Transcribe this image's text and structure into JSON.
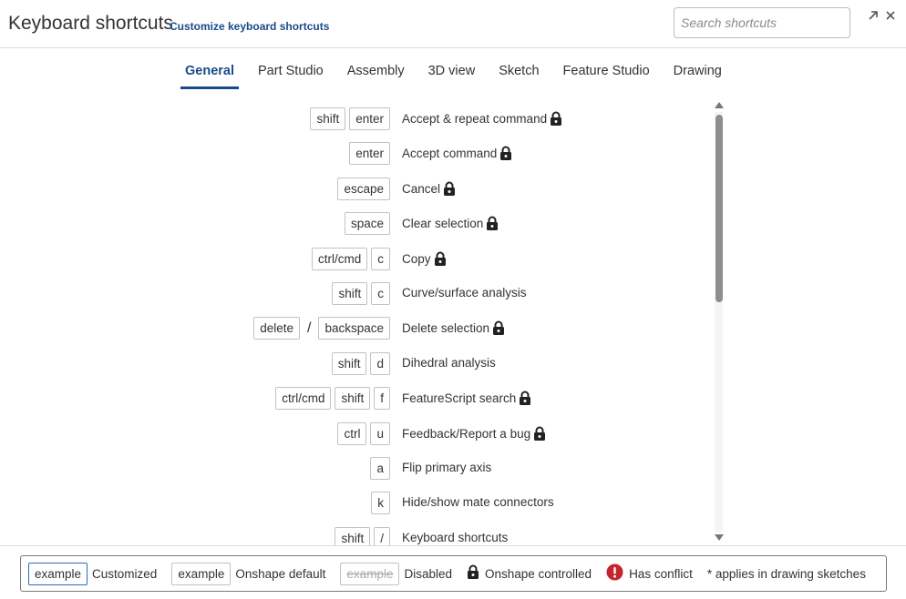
{
  "header": {
    "title": "Keyboard shortcuts",
    "subtitle": "Customize keyboard shortcuts",
    "search_placeholder": "Search shortcuts"
  },
  "tabs": [
    {
      "label": "General",
      "active": true
    },
    {
      "label": "Part Studio"
    },
    {
      "label": "Assembly"
    },
    {
      "label": "3D view"
    },
    {
      "label": "Sketch"
    },
    {
      "label": "Feature Studio"
    },
    {
      "label": "Drawing"
    }
  ],
  "shortcuts": [
    {
      "keys": [
        "shift",
        "enter"
      ],
      "label": "Accept & repeat command",
      "locked": true
    },
    {
      "keys": [
        "enter"
      ],
      "label": "Accept command",
      "locked": true
    },
    {
      "keys": [
        "escape"
      ],
      "label": "Cancel",
      "locked": true
    },
    {
      "keys": [
        "space"
      ],
      "label": "Clear selection",
      "locked": true
    },
    {
      "keys": [
        "ctrl/cmd",
        "c"
      ],
      "label": "Copy",
      "locked": true
    },
    {
      "keys": [
        "shift",
        "c"
      ],
      "label": "Curve/surface analysis",
      "locked": false
    },
    {
      "keys": [
        "delete"
      ],
      "alt_keys": [
        "backspace"
      ],
      "separator": "/",
      "label": "Delete selection",
      "locked": true
    },
    {
      "keys": [
        "shift",
        "d"
      ],
      "label": "Dihedral analysis",
      "locked": false
    },
    {
      "keys": [
        "ctrl/cmd",
        "shift",
        "f"
      ],
      "label": "FeatureScript search",
      "locked": true
    },
    {
      "keys": [
        "ctrl",
        "u"
      ],
      "label": "Feedback/Report a bug",
      "locked": true
    },
    {
      "keys": [
        "a"
      ],
      "label": "Flip primary axis",
      "locked": false
    },
    {
      "keys": [
        "k"
      ],
      "label": "Hide/show mate connectors",
      "locked": false
    },
    {
      "keys": [
        "shift",
        "/"
      ],
      "label": "Keyboard shortcuts",
      "locked": false
    }
  ],
  "legend": {
    "customized_example": "example",
    "customized_label": "Customized",
    "default_example": "example",
    "default_label": "Onshape default",
    "disabled_example": "example",
    "disabled_label": "Disabled",
    "controlled_label": "Onshape controlled",
    "conflict_label": "Has conflict",
    "drawing_label": "* applies in drawing sketches"
  },
  "colors": {
    "accent": "#1a4a8a",
    "conflict": "#c4262e",
    "lock": "#222222"
  }
}
